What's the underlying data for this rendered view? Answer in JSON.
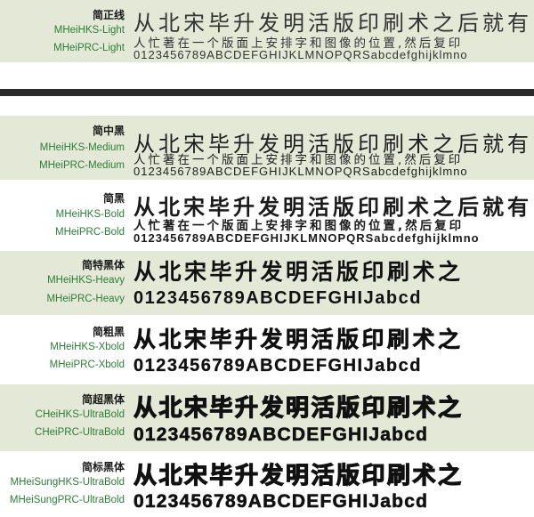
{
  "sample_text": {
    "headline": "从北宋毕升发明活版印刷术之后就有",
    "second_line": "人忙著在一个版面上安排字和图像的位置,然后复印",
    "alphanumeric": "0123456789ABCDEFGHIJKLMNOPQRSabcdefghijklmno",
    "headline_short": "从北宋毕升发明活版印刷术之",
    "alphanumeric_short": "0123456789ABCDEFGHIJabcd"
  },
  "fonts": [
    {
      "cn_name": "简正线",
      "en_names": [
        "MHeiHKS-Light",
        "MHeiPRC-Light"
      ]
    },
    {
      "cn_name": "简中黑",
      "en_names": [
        "MHeiHKS-Medium",
        "MHeiPRC-Medium"
      ]
    },
    {
      "cn_name": "简黑",
      "en_names": [
        "MHeiHKS-Bold",
        "MHeiPRC-Bold"
      ]
    },
    {
      "cn_name": "简特黑体",
      "en_names": [
        "MHeiHKS-Heavy",
        "MHeiPRC-Heavy"
      ]
    },
    {
      "cn_name": "简粗黑",
      "en_names": [
        "MHeiHKS-Xbold",
        "MHeiPRC-Xbold"
      ]
    },
    {
      "cn_name": "简超黑体",
      "en_names": [
        "CHeiHKS-UltraBold",
        "CHeiPRC-UltraBold"
      ]
    },
    {
      "cn_name": "简标黑体",
      "en_names": [
        "MHeiSungHKS-UltraBold",
        "MHeiSungPRC-UltraBold"
      ]
    }
  ],
  "colors": {
    "shaded_row": "#e4e8d6",
    "label_green": "#2e7d3a",
    "divider": "#2a2a2a"
  }
}
